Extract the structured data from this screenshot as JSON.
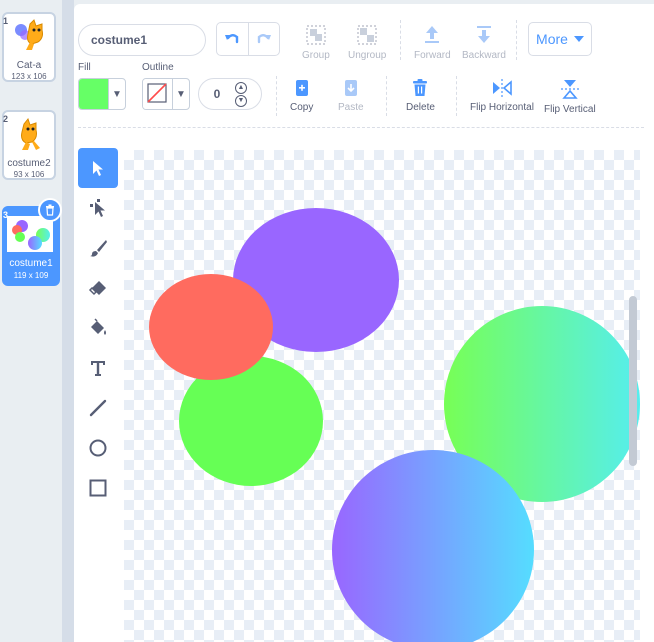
{
  "sidebar": {
    "costumes": [
      {
        "number": "1",
        "name": "Cat-a",
        "size": "123 x 106"
      },
      {
        "number": "2",
        "name": "costume2",
        "size": "93 x 106"
      },
      {
        "number": "3",
        "name": "costume1",
        "size": "119 x 109",
        "selected": true
      }
    ],
    "delete_icon": "trash-icon"
  },
  "toolbar": {
    "costume_name": "costume1",
    "undo_icon": "undo-icon",
    "redo_icon": "redo-icon",
    "group_label": "Group",
    "ungroup_label": "Ungroup",
    "forward_label": "Forward",
    "backward_label": "Backward",
    "more_label": "More"
  },
  "properties": {
    "fill_label": "Fill",
    "fill_color": "#66ff66",
    "outline_label": "Outline",
    "outline_color": "none",
    "outline_width": "0",
    "copy_label": "Copy",
    "paste_label": "Paste",
    "delete_label": "Delete",
    "flip_horizontal_label": "Flip Horizontal",
    "flip_vertical_label": "Flip Vertical"
  },
  "tools": [
    "select",
    "reshape",
    "brush",
    "eraser",
    "fill",
    "text",
    "line",
    "circle",
    "rectangle"
  ],
  "active_tool": "select",
  "colors": {
    "accent": "#4c97ff",
    "purple_circle": "#9966ff",
    "red_circle": "#ff6b5f",
    "green_circle": "#66ff55",
    "gradient_circle_green_to_cyan": [
      "#77ff55",
      "#55eeee"
    ],
    "gradient_circle_purple_to_cyan": [
      "#9966ff",
      "#55ddff"
    ]
  }
}
